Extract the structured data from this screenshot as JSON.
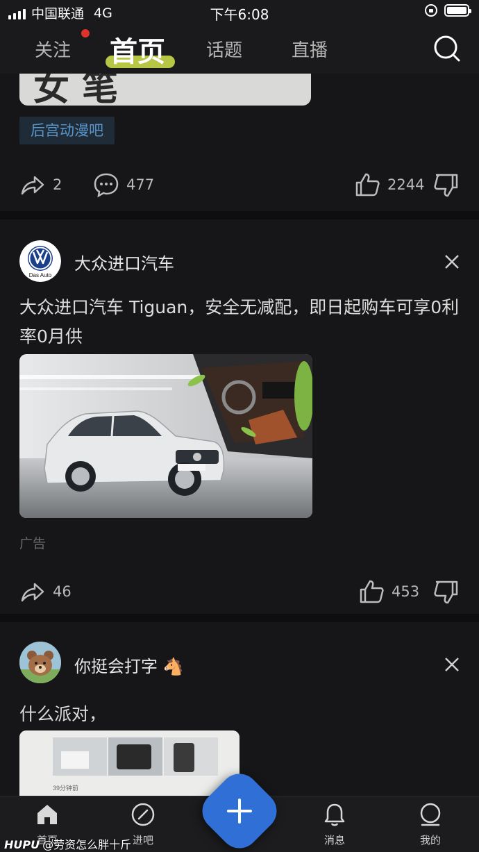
{
  "status_bar": {
    "carrier": "中国联通",
    "network": "4G",
    "time": "下午6:08"
  },
  "top_tabs": [
    {
      "label": "关注",
      "active": false,
      "has_dot": true
    },
    {
      "label": "首页",
      "active": true
    },
    {
      "label": "话题",
      "active": false
    },
    {
      "label": "直播",
      "active": false
    }
  ],
  "feed": {
    "post1": {
      "image_text": "女 笔",
      "tag": "后宫动漫吧",
      "share_count": "2",
      "comment_count": "477",
      "like_count": "2244"
    },
    "post2": {
      "author": "大众进口汽车",
      "avatar_text": "Das Auto",
      "title": "大众进口汽车 Tiguan，安全无减配，即日起购车可享0利率0月供",
      "ad_label": "广告",
      "share_count": "46",
      "like_count": "453"
    },
    "post3": {
      "author": "你挺会打字 🐴",
      "title": "什么派对，",
      "image_caption": "39分钟前"
    }
  },
  "bottom_tabs": [
    {
      "label": "首页",
      "icon": "home-icon"
    },
    {
      "label": "进吧",
      "icon": "compass-icon"
    },
    {
      "label": "消息",
      "icon": "bell-icon"
    },
    {
      "label": "我的",
      "icon": "profile-icon"
    }
  ],
  "watermark": {
    "brand": "HUPU",
    "text": "@劳资怎么胖十斤"
  },
  "colors": {
    "background": "#0e0e10",
    "card": "#161618",
    "accent_underline": "#c9d94a",
    "tag_text": "#5a96c9",
    "fab": "#2f6fd6",
    "notification_dot": "#e0322a"
  }
}
